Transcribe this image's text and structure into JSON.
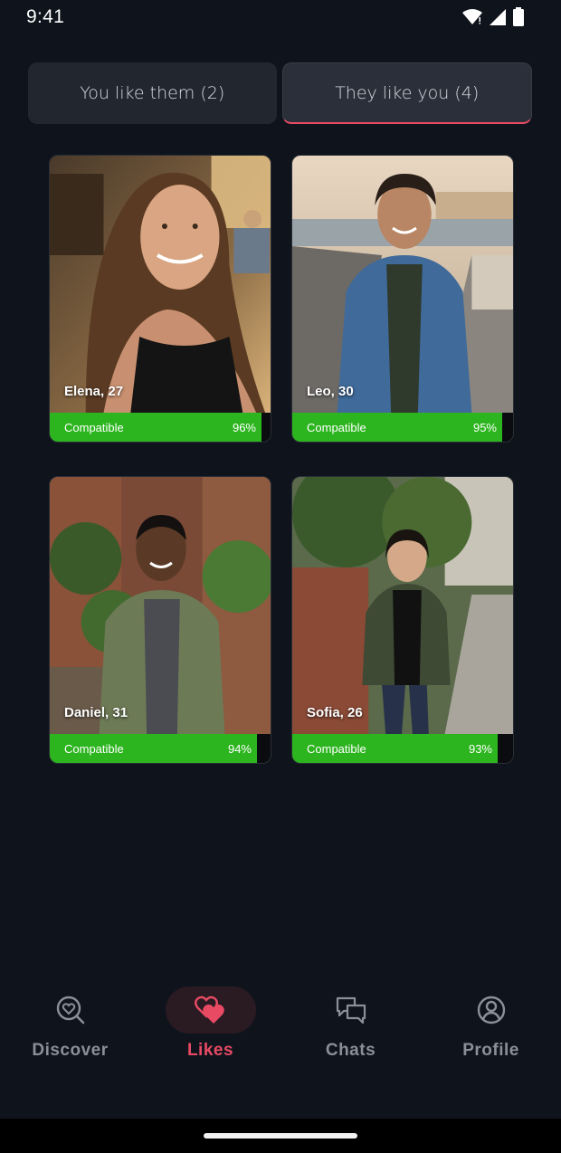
{
  "status_bar": {
    "time": "9:41"
  },
  "tabs": [
    {
      "label": "You like them (2)",
      "active": false
    },
    {
      "label": "They like you (4)",
      "active": true
    }
  ],
  "cards": [
    {
      "name": "Elena, 27",
      "compat_label": "Compatible",
      "compat_pct": "96%",
      "compat_value": 96
    },
    {
      "name": "Leo, 30",
      "compat_label": "Compatible",
      "compat_pct": "95%",
      "compat_value": 95
    },
    {
      "name": "Daniel, 31",
      "compat_label": "Compatible",
      "compat_pct": "94%",
      "compat_value": 94
    },
    {
      "name": "Sofia, 26",
      "compat_label": "Compatible",
      "compat_pct": "93%",
      "compat_value": 93
    }
  ],
  "nav": [
    {
      "label": "Discover",
      "icon": "heart-search-icon",
      "active": false
    },
    {
      "label": "Likes",
      "icon": "double-heart-icon",
      "active": true
    },
    {
      "label": "Chats",
      "icon": "chat-bubbles-icon",
      "active": false
    },
    {
      "label": "Profile",
      "icon": "user-circle-icon",
      "active": false
    }
  ],
  "colors": {
    "accent": "#e84a64",
    "compatible_green": "#2db51f",
    "background": "#0f131c"
  }
}
